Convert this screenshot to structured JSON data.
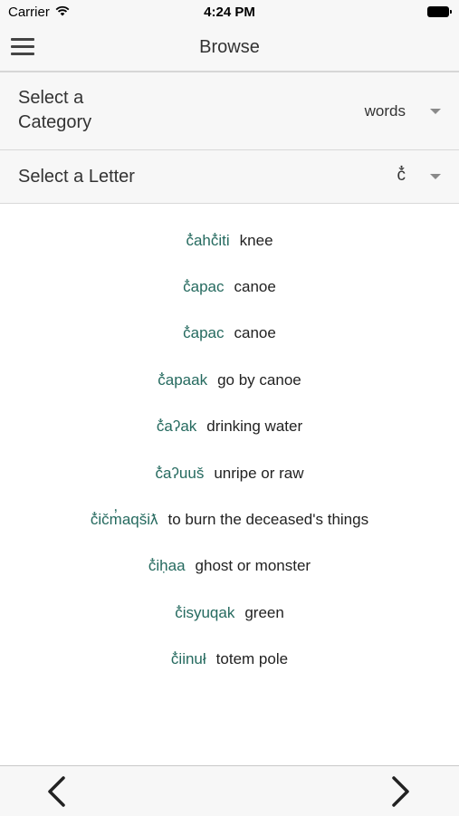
{
  "status_bar": {
    "carrier": "Carrier",
    "time": "4:24 PM"
  },
  "nav": {
    "title": "Browse"
  },
  "category_selector": {
    "label": "Select a Category",
    "value": "words"
  },
  "letter_selector": {
    "label": "Select a Letter",
    "value": "č̓"
  },
  "entries": [
    {
      "native": "č̓ahč̓iti",
      "english": "knee"
    },
    {
      "native": "č̓apac",
      "english": "canoe"
    },
    {
      "native": "č̓apac",
      "english": "canoe"
    },
    {
      "native": "č̓apaak",
      "english": "go by canoe"
    },
    {
      "native": "č̓aʔak",
      "english": "drinking water"
    },
    {
      "native": "č̓aʔuuš",
      "english": "unripe or raw"
    },
    {
      "native": "č̓ičm̓aqšiƛ",
      "english": "to burn the deceased's things"
    },
    {
      "native": "č̓iḥaa",
      "english": "ghost or monster"
    },
    {
      "native": "č̓isyuqak",
      "english": "green"
    },
    {
      "native": "č̓iinuł",
      "english": "totem pole"
    }
  ],
  "icons": {
    "menu": "hamburger-menu-icon",
    "dropdown": "caret-down-icon",
    "previous": "chevron-left-icon",
    "next": "chevron-right-icon",
    "wifi": "wifi-icon",
    "battery": "battery-icon"
  },
  "colors": {
    "native_text": "#256a5f",
    "bar_background": "#f7f7f7"
  }
}
